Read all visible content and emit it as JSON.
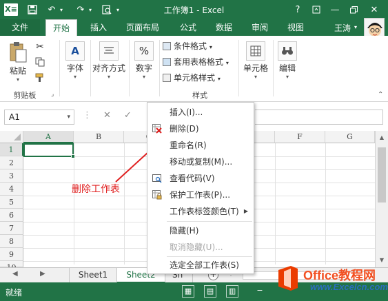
{
  "window": {
    "title": "工作簿1 - Excel",
    "help": "?"
  },
  "qat": {
    "logo": "X≡"
  },
  "tabs": [
    {
      "label": "文件"
    },
    {
      "label": "开始"
    },
    {
      "label": "插入"
    },
    {
      "label": "页面布局"
    },
    {
      "label": "公式"
    },
    {
      "label": "数据"
    },
    {
      "label": "审阅"
    },
    {
      "label": "视图"
    }
  ],
  "user": {
    "name": "王涛"
  },
  "ribbon": {
    "paste_label": "粘贴",
    "clipboard_group": "剪贴板",
    "font_label": "字体",
    "font_icon_glyph": "A",
    "align_label": "对齐方式",
    "number_label": "数字",
    "number_icon_glyph": "%",
    "styles": {
      "conditional": "条件格式",
      "table_format": "套用表格格式",
      "cell_styles": "单元格样式",
      "group": "样式"
    },
    "cells_label": "单元格",
    "edit_label": "编辑"
  },
  "formula_bar": {
    "name_box": "A1",
    "value": ""
  },
  "grid": {
    "columns": [
      "A",
      "B",
      "C",
      "D",
      "E",
      "F",
      "G"
    ],
    "rows": [
      "1",
      "2",
      "3",
      "4",
      "5",
      "6",
      "7",
      "8",
      "9",
      "10"
    ],
    "active_cell": "A1"
  },
  "sheets": {
    "tabs": [
      "Sheet1",
      "Sheet2",
      "Sh"
    ],
    "active": "Sheet2",
    "add": "+"
  },
  "status": {
    "ready": "就绪"
  },
  "context_menu": {
    "items": [
      {
        "label": "插入(I)...",
        "disabled": false
      },
      {
        "label": "删除(D)",
        "disabled": false
      },
      {
        "label": "重命名(R)",
        "disabled": false
      },
      {
        "label": "移动或复制(M)...",
        "disabled": false
      },
      {
        "label": "查看代码(V)",
        "disabled": false
      },
      {
        "label": "保护工作表(P)...",
        "disabled": false
      },
      {
        "label": "工作表标签颜色(T)",
        "disabled": false
      },
      {
        "label": "隐藏(H)",
        "disabled": false
      },
      {
        "label": "取消隐藏(U)...",
        "disabled": true
      },
      {
        "label": "选定全部工作表(S)",
        "disabled": false
      }
    ]
  },
  "annotation": {
    "text": "删除工作表",
    "color": "#e02020"
  },
  "watermark": {
    "line1": "Office教程网",
    "line2": "www.Excelcn.com"
  },
  "colors": {
    "excel_green": "#217346",
    "accent_red": "#e02020"
  }
}
